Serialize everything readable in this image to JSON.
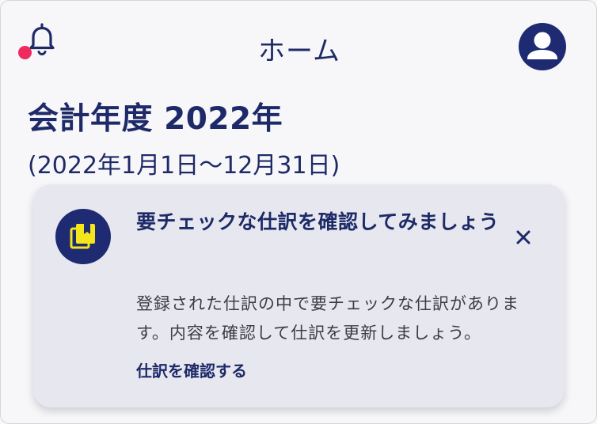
{
  "header": {
    "title": "ホーム",
    "notification_icon": "bell-icon",
    "notification_dot_color": "#ee2a5e",
    "profile_icon": "user-avatar-icon"
  },
  "fiscal_year": {
    "title": "会計年度 2022年",
    "range": "(2022年1月1日〜12月31日)"
  },
  "alert_card": {
    "icon": "journal-bookmark-icon",
    "title": "要チェックな仕訳を確認してみましょう",
    "body": "登録された仕訳の中で要チェックな仕訳があります。内容を確認して仕訳を更新しましょう。",
    "link_label": "仕訳を確認する",
    "close_icon": "close-icon"
  },
  "colors": {
    "primary": "#1e2a68",
    "accent_yellow": "#f5e51b",
    "alert": "#ee2a5e",
    "card_background": "#e7e8ef",
    "page_background": "#f7f7f9"
  }
}
